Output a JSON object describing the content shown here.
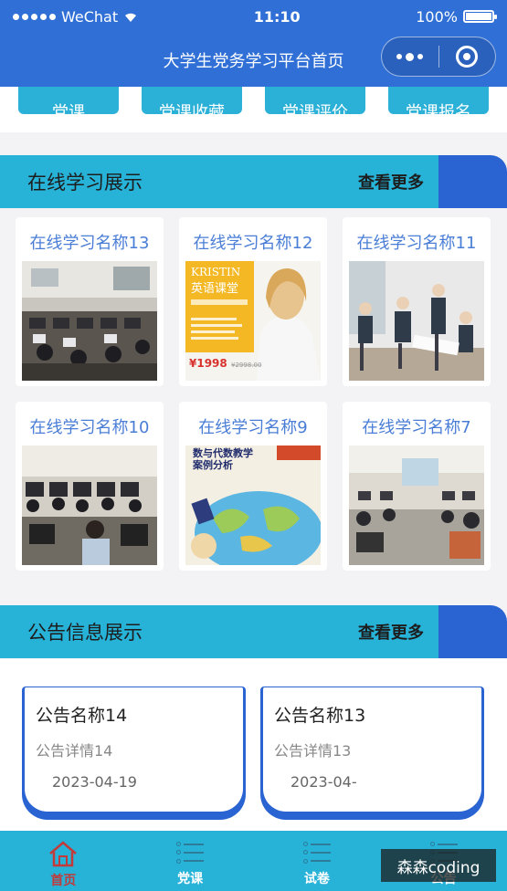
{
  "status_bar": {
    "carrier": "WeChat",
    "time": "11:10",
    "battery": "100%",
    "battery_level": 1.0
  },
  "nav": {
    "title": "大学生党务学习平台首页"
  },
  "categories": [
    {
      "label": "党课"
    },
    {
      "label": "党课收藏"
    },
    {
      "label": "党课评价"
    },
    {
      "label": "党课报名"
    }
  ],
  "learning_section": {
    "title": "在线学习展示",
    "more": "查看更多",
    "items": [
      {
        "title": "在线学习名称13",
        "image": "computer-lab-photo"
      },
      {
        "title": "在线学习名称12",
        "image": "english-class-poster",
        "poster_title": "英语课堂",
        "poster_brand": "KRISTIN",
        "poster_price": "¥1998",
        "poster_old_price": "¥2998.00"
      },
      {
        "title": "在线学习名称11",
        "image": "students-study-photo"
      },
      {
        "title": "在线学习名称10",
        "image": "computer-lab-photo"
      },
      {
        "title": "在线学习名称9",
        "image": "math-book-cover",
        "cover_title": "数与代数教学\n案例分析"
      },
      {
        "title": "在线学习名称7",
        "image": "computer-lab-photo"
      }
    ]
  },
  "notice_section": {
    "title": "公告信息展示",
    "more": "查看更多",
    "items": [
      {
        "title": "公告名称14",
        "detail": "公告详情14",
        "date": "2023-04-19"
      },
      {
        "title": "公告名称13",
        "detail": "公告详情13",
        "date": "2023-04-"
      }
    ]
  },
  "tabbar": [
    {
      "label": "首页",
      "icon": "home-icon",
      "active": true
    },
    {
      "label": "党课",
      "icon": "list-icon",
      "active": false
    },
    {
      "label": "试卷",
      "icon": "list-icon",
      "active": false
    },
    {
      "label": "公告",
      "icon": "list-icon",
      "active": false
    }
  ],
  "watermark": "森森coding",
  "colors": {
    "primary_blue": "#2f6fd6",
    "accent_cyan": "#27b2d8",
    "title_blue": "#4a7ed6",
    "active_red": "#c23a3a"
  }
}
